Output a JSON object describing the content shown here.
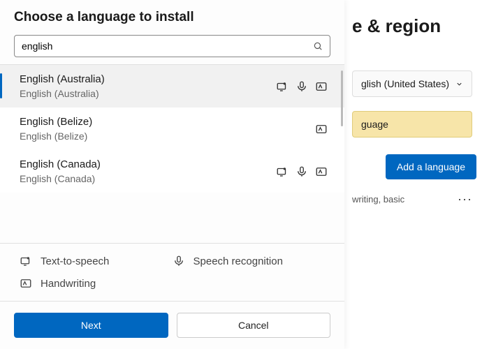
{
  "dialog": {
    "title": "Choose a language to install",
    "search_value": "english"
  },
  "langs": [
    {
      "name": "English (Australia)",
      "native": "English (Australia)",
      "tts": true,
      "speech": true,
      "hand": true
    },
    {
      "name": "English (Belize)",
      "native": "English (Belize)",
      "tts": false,
      "speech": false,
      "hand": true
    },
    {
      "name": "English (Canada)",
      "native": "English (Canada)",
      "tts": true,
      "speech": true,
      "hand": true
    }
  ],
  "legend": {
    "tts": "Text-to-speech",
    "speech": "Speech recognition",
    "hand": "Handwriting"
  },
  "buttons": {
    "next": "Next",
    "cancel": "Cancel"
  },
  "bg": {
    "title": "e & region",
    "selected_lang": "glish (United States)",
    "banner": "guage",
    "add": "Add a language",
    "item_sub": "writing, basic"
  }
}
